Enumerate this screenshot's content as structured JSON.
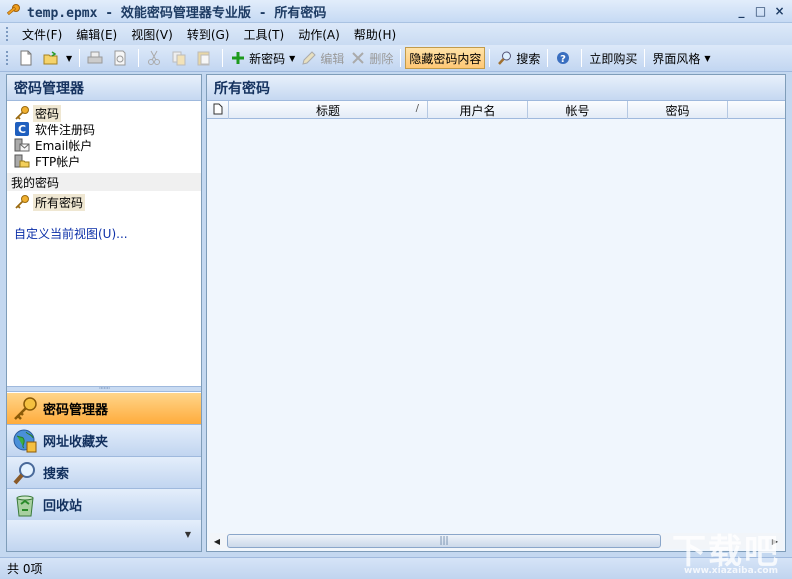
{
  "window": {
    "title": "temp.epmx - 效能密码管理器专业版 - 所有密码",
    "minimize": "_",
    "maximize": "□",
    "close": "×"
  },
  "menu": [
    {
      "label": "文件(F)"
    },
    {
      "label": "编辑(E)"
    },
    {
      "label": "视图(V)"
    },
    {
      "label": "转到(G)"
    },
    {
      "label": "工具(T)"
    },
    {
      "label": "动作(A)"
    },
    {
      "label": "帮助(H)"
    }
  ],
  "toolbar": {
    "new_password": "新密码",
    "edit": "编辑",
    "delete": "删除",
    "hide_content": "隐藏密码内容",
    "search": "搜索",
    "buy_now": "立即购买",
    "theme": "界面风格"
  },
  "left_pane": {
    "header": "密码管理器",
    "tree": [
      {
        "label": "密码",
        "icon": "key-icon"
      },
      {
        "label": "软件注册码",
        "icon": "software-icon"
      },
      {
        "label": "Email帐户",
        "icon": "email-icon"
      },
      {
        "label": "FTP帐户",
        "icon": "ftp-icon"
      }
    ],
    "my_passwords_label": "我的密码",
    "all_passwords": "所有密码",
    "customize_link": "自定义当前视图(U)..."
  },
  "nav_buttons": [
    {
      "label": "密码管理器",
      "icon": "key-icon",
      "active": true
    },
    {
      "label": "网址收藏夹",
      "icon": "globe-icon",
      "active": false
    },
    {
      "label": "搜索",
      "icon": "magnifier-icon",
      "active": false
    },
    {
      "label": "回收站",
      "icon": "recycle-bin-icon",
      "active": false
    }
  ],
  "right_pane": {
    "header": "所有密码",
    "columns": [
      "标题",
      "用户名",
      "帐号",
      "密码"
    ],
    "sort_mark": "/"
  },
  "status": {
    "count_text": "共 0项"
  },
  "watermark": {
    "main": "下载吧",
    "sub": "www.xiazaiba.com"
  },
  "colors": {
    "accent_orange": "#ffac3c",
    "header_blue": "#c5d8f1",
    "link_blue": "#0b2fa8"
  }
}
